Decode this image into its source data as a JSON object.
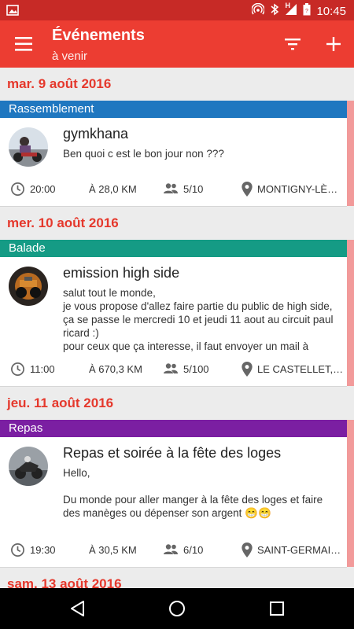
{
  "status_bar": {
    "time": "10:45",
    "icons": [
      "image-icon",
      "hotspot-icon",
      "bluetooth-icon",
      "signal-icon",
      "battery-icon"
    ],
    "network_label": "H"
  },
  "app_bar": {
    "title": "Événements",
    "subtitle": "à venir",
    "icons": [
      "menu-icon",
      "filter-icon",
      "add-icon"
    ]
  },
  "colors": {
    "primary": "#ec3d32",
    "status_bar": "#c72a26",
    "date_header_text": "#e5382c",
    "category_rassemblement": "#1f77c0",
    "category_balade": "#159b85",
    "category_repas": "#7b1fa2"
  },
  "events": [
    {
      "date": "mar. 9 août 2016",
      "category": "Rassemblement",
      "category_color": "#1f77c0",
      "title": "gymkhana",
      "description": "Ben quoi c est le bon jour non ???",
      "time": "20:00",
      "distance": "À 28,0 KM",
      "participants": "5/10",
      "location": "MONTIGNY-LÈS…"
    },
    {
      "date": "mer. 10 août 2016",
      "category": "Balade",
      "category_color": "#159b85",
      "title": "emission high side",
      "description": "salut tout le monde,\nje vous propose d'allez faire partie du public de high side,\nça se passe le mercredi 10 et jeudi 11 aout au circuit paul ricard :)\npour ceux que ça interesse, il faut envoyer un mail à",
      "time": "11:00",
      "distance": "À 670,3 KM",
      "participants": "5/100",
      "location": "LE CASTELLET,…"
    },
    {
      "date": "jeu. 11 août 2016",
      "category": "Repas",
      "category_color": "#7b1fa2",
      "title": "Repas et soirée à la fête des loges",
      "description": "Hello,\n\nDu monde pour aller manger à la fête des loges et faire des manèges ou dépenser son argent 😁😁",
      "time": "19:30",
      "distance": "À 30,5 KM",
      "participants": "6/10",
      "location": "SAINT-GERMAI…"
    }
  ],
  "next_date": "sam. 13 août 2016",
  "nav_bar": {
    "icons": [
      "back-icon",
      "home-icon",
      "recents-icon"
    ]
  }
}
